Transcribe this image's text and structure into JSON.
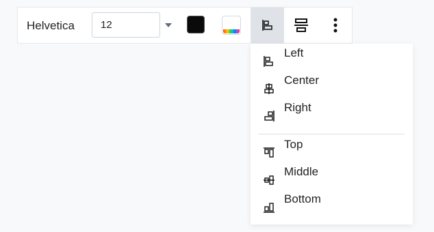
{
  "toolbar": {
    "font_family": "Helvetica",
    "font_size_value": "12",
    "text_color": "#0a0a0a",
    "background_color": "#ffffff",
    "active_button_bg": "#dfe3e8"
  },
  "icons": {
    "size_dropdown": "caret-down-icon",
    "text_color": "text-color-swatch",
    "background_color": "background-color-rainbow-swatch",
    "horizontal_align": "align-left-icon",
    "vertical_align": "align-vertical-center-icon",
    "more": "more-vertical-icon"
  },
  "align_menu": {
    "horizontal": [
      {
        "label": "Left",
        "icon": "align-left-icon"
      },
      {
        "label": "Center",
        "icon": "align-center-icon"
      },
      {
        "label": "Right",
        "icon": "align-right-icon"
      }
    ],
    "vertical": [
      {
        "label": "Top",
        "icon": "align-top-icon"
      },
      {
        "label": "Middle",
        "icon": "align-middle-icon"
      },
      {
        "label": "Bottom",
        "icon": "align-bottom-icon"
      }
    ]
  }
}
